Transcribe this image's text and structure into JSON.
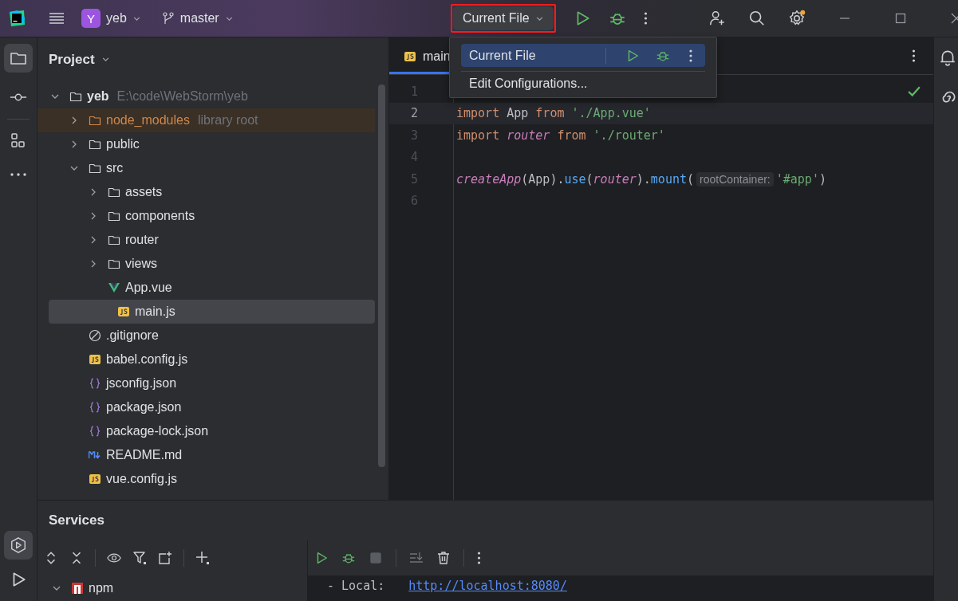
{
  "titlebar": {
    "project_initial": "Y",
    "project": "yeb",
    "branch": "master",
    "run_config": "Current File",
    "run_config_highlighted": true
  },
  "run_menu": {
    "items": [
      {
        "kind": "config",
        "label": "Current File",
        "selected": true
      },
      {
        "kind": "action",
        "label": "Edit Configurations...",
        "selected": false
      }
    ]
  },
  "project_panel": {
    "title": "Project",
    "tree": [
      {
        "name": "yeb",
        "path": "E:\\code\\WebStorm\\yeb",
        "kind": "folder",
        "expanded": true,
        "selected": false,
        "children": [
          {
            "name": "node_modules",
            "note": "library root",
            "kind": "library",
            "expanded": false,
            "selected": false
          },
          {
            "name": "public",
            "kind": "folder",
            "expanded": false,
            "selected": false
          },
          {
            "name": "src",
            "kind": "folder",
            "expanded": true,
            "selected": false,
            "children": [
              {
                "name": "assets",
                "kind": "folder",
                "expanded": false,
                "selected": false
              },
              {
                "name": "components",
                "kind": "folder",
                "expanded": false,
                "selected": false
              },
              {
                "name": "router",
                "kind": "folder",
                "expanded": false,
                "selected": false
              },
              {
                "name": "views",
                "kind": "folder",
                "expanded": false,
                "selected": false
              },
              {
                "name": "App.vue",
                "kind": "vue",
                "selected": false
              },
              {
                "name": "main.js",
                "kind": "js",
                "selected": true
              }
            ]
          },
          {
            "name": ".gitignore",
            "kind": "ignore",
            "selected": false
          },
          {
            "name": "babel.config.js",
            "kind": "js",
            "selected": false
          },
          {
            "name": "jsconfig.json",
            "kind": "json",
            "selected": false
          },
          {
            "name": "package.json",
            "kind": "json",
            "selected": false
          },
          {
            "name": "package-lock.json",
            "kind": "json",
            "selected": false
          },
          {
            "name": "README.md",
            "kind": "md",
            "selected": false
          },
          {
            "name": "vue.config.js",
            "kind": "js",
            "selected": false
          }
        ]
      }
    ]
  },
  "editor": {
    "tabs": [
      {
        "label": "main",
        "kind": "js",
        "selected": true
      }
    ],
    "lines": [
      {
        "number": "1",
        "current": false
      },
      {
        "number": "2",
        "current": true,
        "tokens": [
          {
            "text": "import",
            "kind": "keyword"
          },
          {
            "text": " App ",
            "kind": "plain"
          },
          {
            "text": "from",
            "kind": "keyword"
          },
          {
            "text": " './App.vue'",
            "kind": "string"
          }
        ]
      },
      {
        "number": "3",
        "current": false,
        "tokens": [
          {
            "text": "import ",
            "kind": "keyword"
          },
          {
            "text": "router",
            "kind": "variable"
          },
          {
            "text": " from ",
            "kind": "keyword"
          },
          {
            "text": "'./router'",
            "kind": "string"
          }
        ]
      },
      {
        "number": "4",
        "current": false
      },
      {
        "number": "5",
        "current": false,
        "tokens": [
          {
            "text": "createApp",
            "kind": "variable"
          },
          {
            "text": "(App).",
            "kind": "plain"
          },
          {
            "text": "use",
            "kind": "method"
          },
          {
            "text": "(",
            "kind": "plain"
          },
          {
            "text": "router",
            "kind": "variable"
          },
          {
            "text": ").",
            "kind": "plain"
          },
          {
            "text": "mount",
            "kind": "method"
          },
          {
            "text": "(",
            "kind": "plain"
          },
          {
            "text": "rootContainer:",
            "kind": "hint"
          },
          {
            "text": "'#app'",
            "kind": "string"
          },
          {
            "text": ")",
            "kind": "plain"
          }
        ]
      },
      {
        "number": "6",
        "current": false
      }
    ]
  },
  "services": {
    "title": "Services",
    "tree": [
      {
        "name": "npm",
        "expanded": true
      }
    ],
    "output": [
      {
        "label": "- Local:",
        "link": "http://localhost:8080/"
      }
    ]
  }
}
